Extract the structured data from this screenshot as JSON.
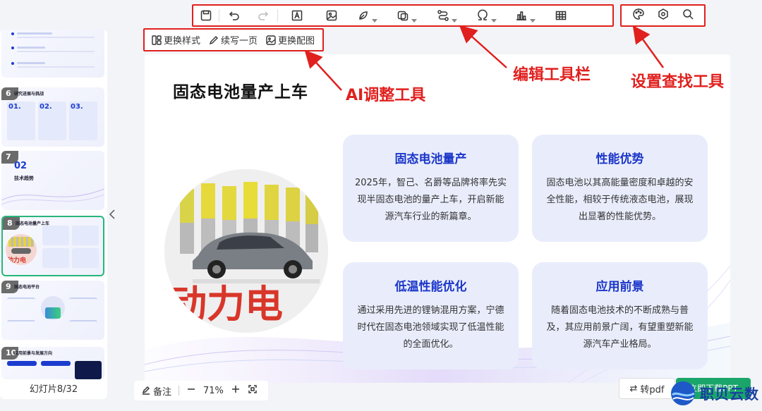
{
  "toolbar": {
    "items": [
      "save-icon",
      "undo-icon",
      "redo-icon",
      "text-box-icon",
      "image-icon",
      "shape-icon",
      "layout-icon",
      "flow-icon",
      "symbol-icon",
      "chart-icon",
      "table-icon"
    ]
  },
  "settings": {
    "items": [
      "palette-icon",
      "settings-icon",
      "search-icon"
    ]
  },
  "ai_toolbar": {
    "change_style": "更换样式",
    "continue_page": "续写一页",
    "change_image": "更换配图"
  },
  "sidebar": {
    "slides": [
      {
        "num": "6",
        "title": "研究进展与挑战",
        "items": [
          "01.",
          "02.",
          "03."
        ]
      },
      {
        "num": "7",
        "title": "技术趋势",
        "items": [
          "02"
        ]
      },
      {
        "num": "8",
        "title": "固态电池量产上车",
        "active": true
      },
      {
        "num": "9",
        "title": "固态电池平台"
      },
      {
        "num": "10",
        "title": "应用前景与发展方向"
      }
    ],
    "slide_count": "幻灯片8/32"
  },
  "slide": {
    "title": "固态电池量产上车",
    "photo_text": "动力电",
    "features": [
      {
        "title": "固态电池量产",
        "body": "2025年，智己、名爵等品牌将率先实现半固态电池的量产上车，开启新能源汽车行业的新篇章。"
      },
      {
        "title": "性能优势",
        "body": "固态电池以其高能量密度和卓越的安全性能，相较于传统液态电池，展现出显著的性能优势。"
      },
      {
        "title": "低温性能优化",
        "body": "通过采用先进的锂钠混用方案，宁德时代在固态电池领域实现了低温性能的全面优化。"
      },
      {
        "title": "应用前景",
        "body": "随着固态电池技术的不断成熟与普及，其应用前景广阔，有望重塑新能源汽车产业格局。"
      }
    ]
  },
  "bottombar": {
    "notes_label": "备注",
    "zoom": "71%",
    "to_pdf": "转pdf",
    "download": "立即下载PPT"
  },
  "annotations": {
    "ai_tools": "AI调整工具",
    "edit_toolbar": "编辑工具栏",
    "settings_search": "设置查找工具"
  },
  "watermark": "职贝云数",
  "colors": {
    "accent": "#1b36c9",
    "annotation_red": "#e0201e",
    "active_green": "#26b67a"
  }
}
